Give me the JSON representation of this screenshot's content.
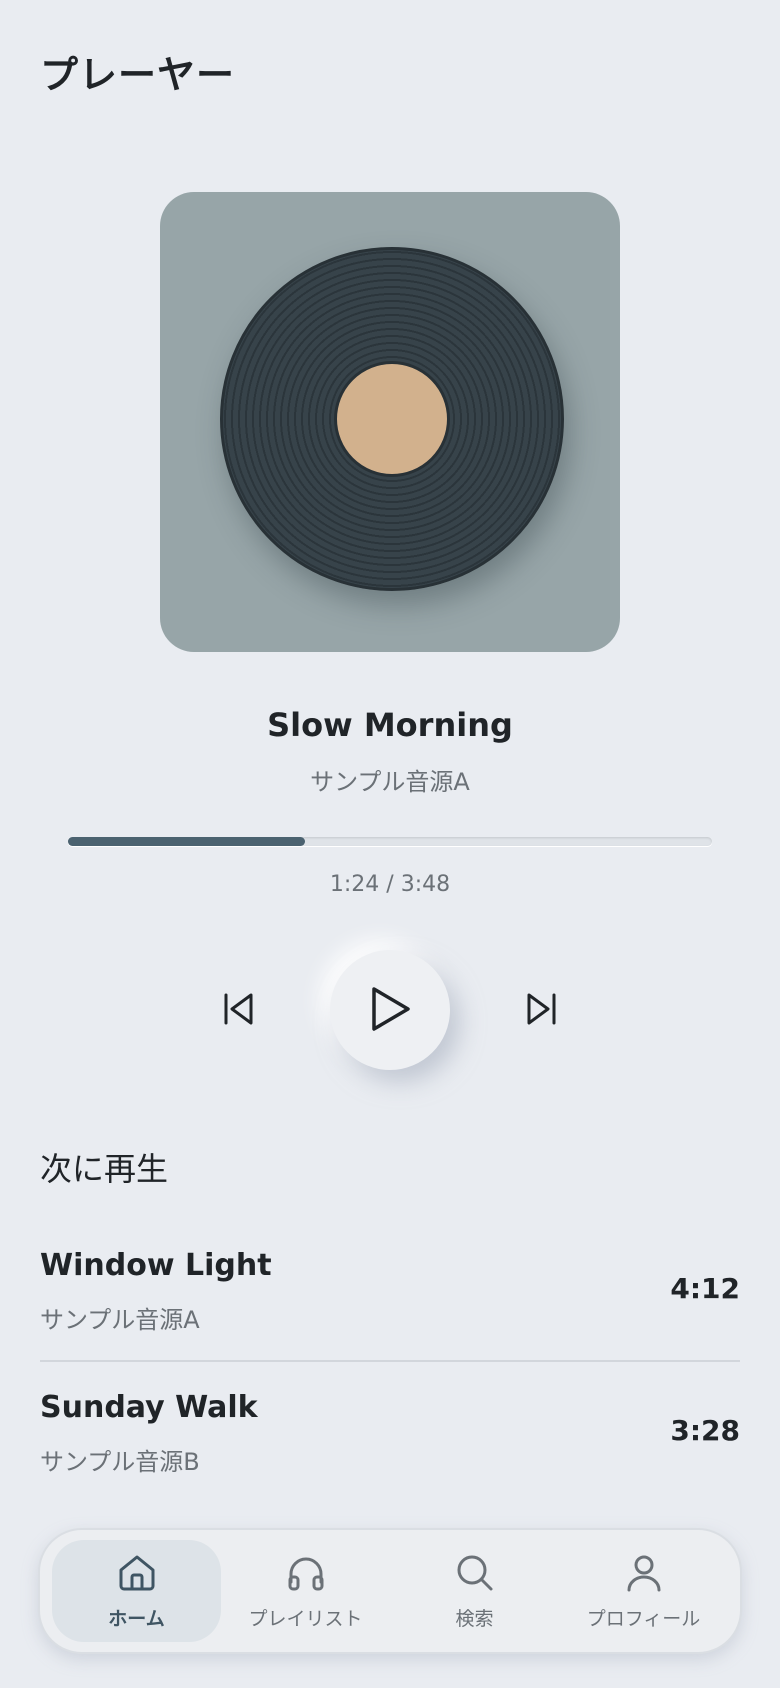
{
  "header": {
    "title": "プレーヤー"
  },
  "now_playing": {
    "title": "Slow Morning",
    "artist": "サンプル音源A",
    "time_display": "1:24 / 3:48",
    "progress_fraction": 0.368
  },
  "controls": {
    "prev_icon": "skip-previous-icon",
    "play_icon": "play-icon",
    "next_icon": "skip-next-icon"
  },
  "queue": {
    "title": "次に再生",
    "items": [
      {
        "title": "Window Light",
        "artist": "サンプル音源A",
        "duration": "4:12"
      },
      {
        "title": "Sunday Walk",
        "artist": "サンプル音源B",
        "duration": "3:28"
      }
    ]
  },
  "bottom_nav": {
    "items": [
      {
        "label": "ホーム",
        "icon": "home-icon",
        "active": true
      },
      {
        "label": "プレイリスト",
        "icon": "headphones-icon",
        "active": false
      },
      {
        "label": "検索",
        "icon": "search-icon",
        "active": false
      },
      {
        "label": "プロフィール",
        "icon": "user-icon",
        "active": false
      }
    ]
  },
  "colors": {
    "background": "#e9ecf1",
    "accent": "#4b6270",
    "cover_background": "#97a5a8",
    "vinyl_label": "#d2b18d"
  }
}
